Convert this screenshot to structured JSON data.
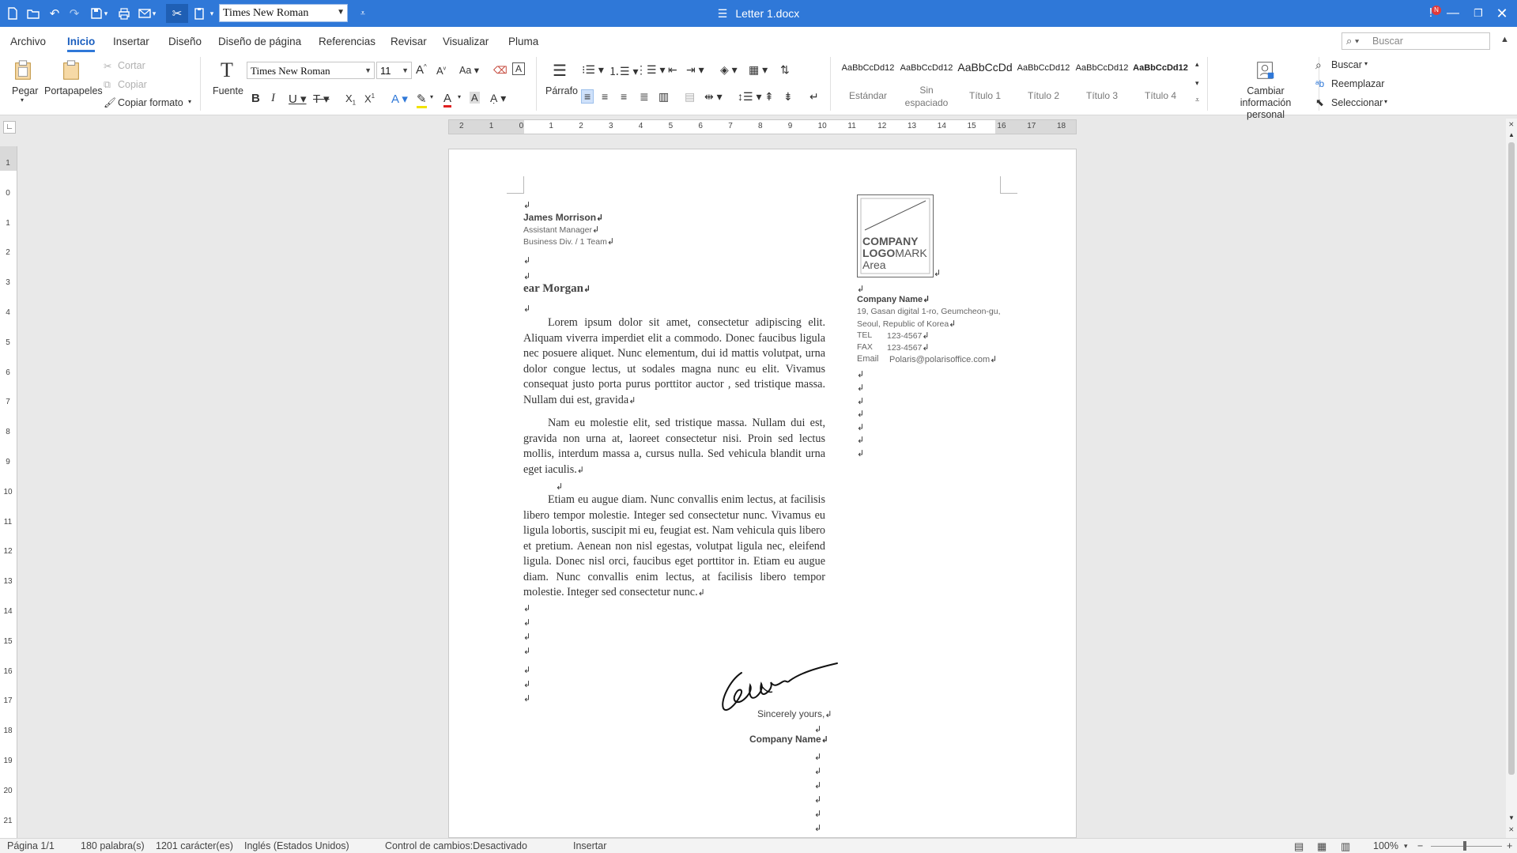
{
  "titlebar": {
    "document_title": "Letter 1.docx",
    "quick_font": "Times New Roman",
    "notification_badge": "N"
  },
  "menu": {
    "items": [
      "Archivo",
      "Inicio",
      "Insertar",
      "Diseño",
      "Diseño de página",
      "Referencias",
      "Revisar",
      "Visualizar",
      "Pluma"
    ],
    "active": "Inicio",
    "search_placeholder": "Buscar"
  },
  "ribbon": {
    "paste": "Pegar",
    "clipboard": "Portapapeles",
    "cut": "Cortar",
    "copy": "Copiar",
    "format_painter": "Copiar formato",
    "font_group": "Fuente",
    "font_name": "Times New Roman",
    "font_size": "11",
    "paragraph_group": "Párrafo",
    "styles": [
      {
        "preview": "AaBbCcDd12",
        "name": "Estándar"
      },
      {
        "preview": "AaBbCcDd12",
        "name": "Sin espaciado"
      },
      {
        "preview": "AaBbCcDd",
        "name": "Título 1"
      },
      {
        "preview": "AaBbCcDd12",
        "name": "Título 2"
      },
      {
        "preview": "AaBbCcDd12",
        "name": "Título 3"
      },
      {
        "preview": "AaBbCcDd12",
        "name": "Título 4"
      }
    ],
    "personal_info": "Cambiar información personal",
    "find": "Buscar",
    "replace": "Reemplazar",
    "select": "Seleccionar"
  },
  "rulers": {
    "horizontal": [
      "2",
      "1",
      "0",
      "1",
      "2",
      "3",
      "4",
      "5",
      "6",
      "7",
      "8",
      "9",
      "10",
      "11",
      "12",
      "13",
      "14",
      "15",
      "16",
      "17",
      "18"
    ],
    "vertical": [
      "1",
      "0",
      "1",
      "2",
      "3",
      "4",
      "5",
      "6",
      "7",
      "8",
      "9",
      "10",
      "11",
      "12",
      "13",
      "14",
      "15",
      "16",
      "17",
      "18",
      "19",
      "20",
      "21"
    ]
  },
  "document": {
    "sender_name": "James Morrison",
    "sender_title": "Assistant Manager",
    "sender_dept": "Business Div. / 1 Team",
    "greeting": "ear Morgan",
    "para1": "Lorem ipsum dolor sit amet, consectetur adipiscing elit. Aliquam viverra imperdiet elit a commodo. Donec faucibus ligula nec posuere aliquet. Nunc elementum, dui id mattis volutpat, urna dolor congue lectus, ut sodales magna nunc eu elit. Vivamus consequat justo porta purus porttitor auctor , sed tristique massa. Nullam dui est, gravida",
    "para2": "Nam eu molestie elit, sed tristique massa. Nullam dui est, gravida non urna at, laoreet consectetur nisi. Proin sed lectus mollis, interdum massa a, cursus nulla. Sed vehicula blandit urna eget iaculis.",
    "para3": "Etiam eu augue diam. Nunc convallis enim lectus, at facilisis libero tempor molestie. Integer sed consectetur nunc. Vivamus eu ligula lobortis, suscipit mi eu, feugiat est. Nam vehicula quis libero et pretium. Aenean non nisl egestas, volutpat ligula nec, eleifend ligula. Donec nisl orci, faucibus eget porttitor in. Etiam eu augue diam. Nunc convallis enim lectus, at facilisis libero tempor molestie. Integer sed consectetur nunc.",
    "logo_line1": "COMPANY",
    "logo_line2a": "LOGO",
    "logo_line2b": "MARK",
    "logo_line3": "Area",
    "company_name": "Company Name",
    "address1": "19, Gasan digital 1-ro, Geumcheon-gu,",
    "address2": "Seoul, Republic of Korea",
    "tel_label": "TEL",
    "tel": "123-4567",
    "fax_label": "FAX",
    "fax": "123-4567",
    "email_label": "Email",
    "email": "Polaris@polarisoffice.com",
    "closing": "Sincerely yours,",
    "closing_company": "Company Name"
  },
  "status": {
    "page": "Página 1/1",
    "words": "180 palabra(s)",
    "chars": "1201 carácter(es)",
    "language": "Inglés (Estados Unidos)",
    "track_changes": "Control de cambios:Desactivado",
    "mode": "Insertar",
    "zoom": "100%"
  },
  "colors": {
    "titlebar": "#2f78d8",
    "accent": "#1b5fbf"
  }
}
